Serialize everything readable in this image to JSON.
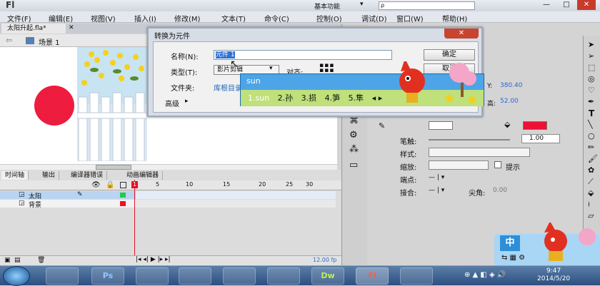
{
  "app": {
    "logo": "Fl",
    "workspace": "基本功能",
    "search_placeholder": "ρ"
  },
  "window_controls": {
    "minimize": "—",
    "maximize": "□",
    "close": "✕"
  },
  "menu": [
    "文件(F)",
    "编辑(E)",
    "视图(V)",
    "插入(I)",
    "修改(M)",
    "文本(T)",
    "命令(C)",
    "控制(O)",
    "调试(D)",
    "窗口(W)",
    "帮助(H)"
  ],
  "document": {
    "tab": "太阳升起.fla*",
    "tab_close": "✕",
    "scene": "场景 1"
  },
  "panel_tabs": [
    "时间轴",
    "输出",
    "编译器错误",
    "动画编辑器"
  ],
  "timeline": {
    "frame_numbers": [
      "1",
      "5",
      "10",
      "15",
      "20",
      "25",
      "30"
    ],
    "layers": [
      {
        "name": "太阳",
        "selected": true,
        "color": "#22cc44"
      },
      {
        "name": "背景",
        "selected": false,
        "color": "#ee1122"
      }
    ],
    "fps": "12.00 fp"
  },
  "dialog": {
    "title": "转换为元件",
    "name_label": "名称(N):",
    "name_value": "元件 1",
    "type_label": "类型(T):",
    "type_value": "影片剪辑",
    "align_label": "对齐:",
    "folder_label": "文件夹:",
    "folder_value": "库根目录",
    "advanced_label": "高级",
    "ok_label": "确定",
    "cancel_label": "取消"
  },
  "ime": {
    "typed": "sun",
    "candidates": [
      "1.sun",
      "2.孙",
      "3.损",
      "4.笋",
      "5.隼"
    ],
    "nav": "◂ ▸",
    "status_label": "中"
  },
  "properties": {
    "y_label": "Y:",
    "y_value": "380.40",
    "h_label": "高:",
    "h_value": "52.00",
    "stroke_label": "笔触:",
    "stroke_value": "1.00",
    "style_label": "样式:",
    "scale_label": "缩放:",
    "hint_label": "提示",
    "cap_label": "端点:",
    "join_label": "接合:",
    "miter_label": "尖角:",
    "miter_value": "0.00",
    "fill_color": "#ee1133"
  },
  "taskbar": {
    "time": "9:47",
    "date": "2014/5/20",
    "apps": [
      "",
      "Ps",
      "",
      "",
      "",
      "",
      "Dw",
      "Fl",
      ""
    ]
  }
}
